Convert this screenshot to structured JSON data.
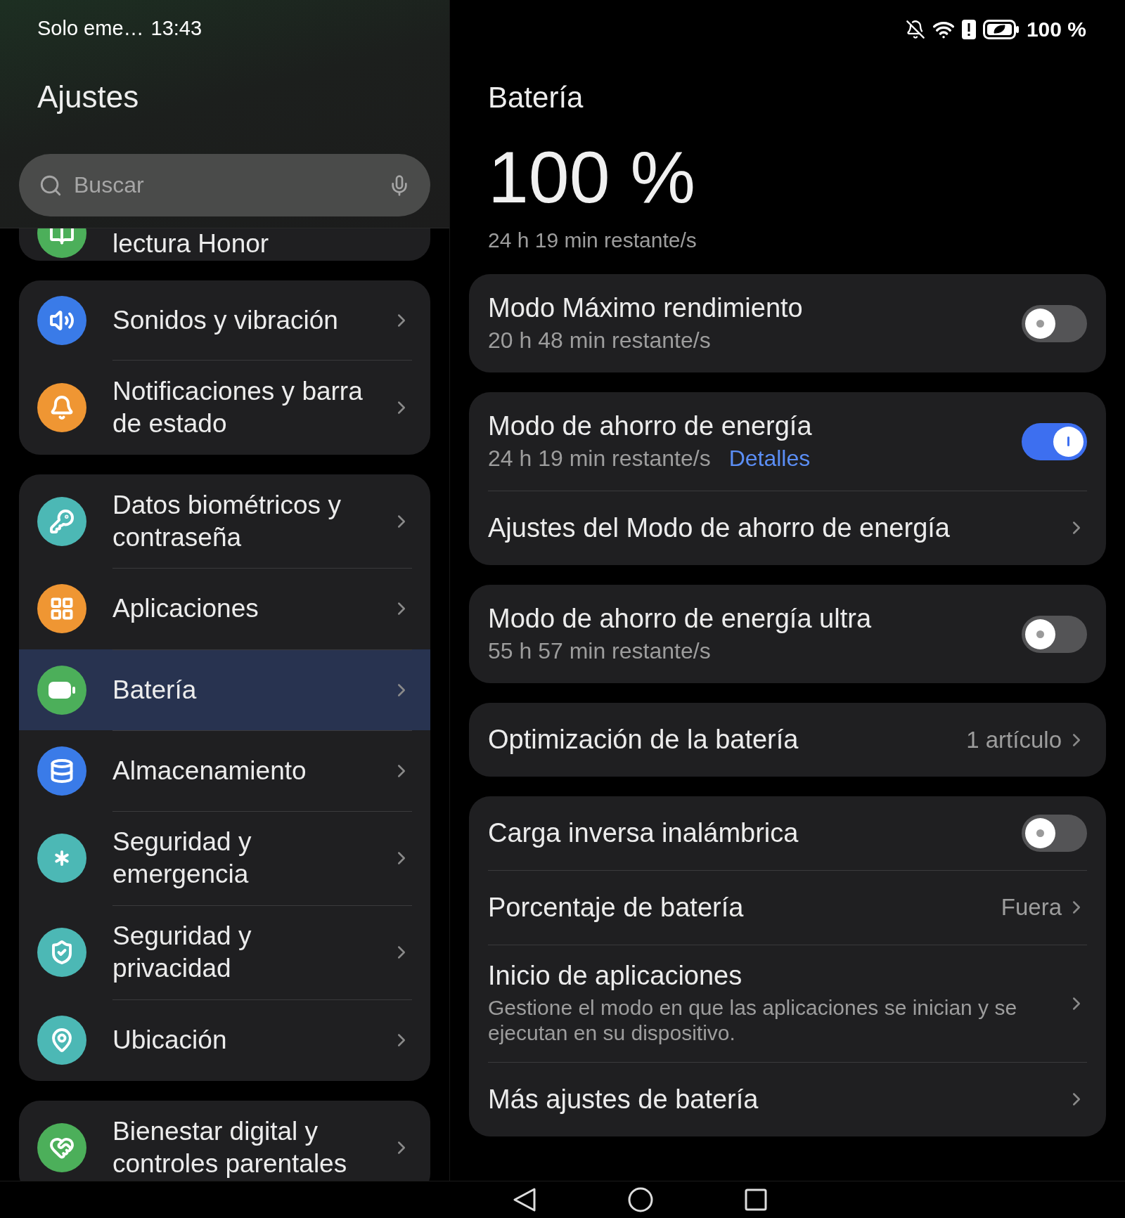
{
  "status_bar": {
    "carrier": "Solo eme…",
    "time": "13:43",
    "battery": "100 %"
  },
  "sidebar": {
    "title": "Ajustes",
    "search": {
      "placeholder": "Buscar"
    },
    "groups": [
      {
        "items": [
          {
            "label": "lectura Honor",
            "color": "#4caf5a",
            "selected": false
          }
        ]
      },
      {
        "items": [
          {
            "label": "Sonidos y vibración",
            "color": "#3a7be8",
            "selected": false
          },
          {
            "label": "Notificaciones y barra de estado",
            "color": "#ef9633",
            "selected": false
          }
        ]
      },
      {
        "items": [
          {
            "label": "Datos biométricos y contraseña",
            "color": "#4cb8b5",
            "selected": false
          },
          {
            "label": "Aplicaciones",
            "color": "#ef9633",
            "selected": false
          },
          {
            "label": "Batería",
            "color": "#4caf5a",
            "selected": true
          },
          {
            "label": "Almacenamiento",
            "color": "#3a7be8",
            "selected": false
          },
          {
            "label": "Seguridad y emergencia",
            "color": "#4cb8b5",
            "selected": false
          },
          {
            "label": "Seguridad y privacidad",
            "color": "#4cb8b5",
            "selected": false
          },
          {
            "label": "Ubicación",
            "color": "#4cb8b5",
            "selected": false
          }
        ]
      },
      {
        "items": [
          {
            "label": "Bienestar digital y controles parentales",
            "color": "#4caf5a",
            "selected": false
          }
        ]
      }
    ]
  },
  "detail": {
    "title": "Batería",
    "level_text": "100 %",
    "remaining": "24 h 19 min restante/s",
    "groups": [
      {
        "rows": [
          {
            "kind": "toggle",
            "title": "Modo Máximo rendimiento",
            "subtitle": "20 h 48 min restante/s",
            "on": false
          }
        ]
      },
      {
        "rows": [
          {
            "kind": "toggle",
            "title": "Modo de ahorro de energía",
            "subtitle": "24 h 19 min restante/s",
            "link_text": "Detalles",
            "on": true
          },
          {
            "kind": "link",
            "title": "Ajustes del Modo de ahorro de energía"
          }
        ]
      },
      {
        "rows": [
          {
            "kind": "toggle",
            "title": "Modo de ahorro de energía ultra",
            "subtitle": "55 h 57 min restante/s",
            "on": false
          }
        ]
      },
      {
        "rows": [
          {
            "kind": "link",
            "title": "Optimización de la batería",
            "value": "1 artículo"
          }
        ]
      },
      {
        "rows": [
          {
            "kind": "toggle",
            "title": "Carga inversa inalámbrica",
            "on": false
          },
          {
            "kind": "link",
            "title": "Porcentaje de batería",
            "value": "Fuera"
          },
          {
            "kind": "link",
            "title": "Inicio de aplicaciones",
            "description": "Gestione el modo en que las aplicaciones se inician y se ejecutan en su dispositivo."
          },
          {
            "kind": "link",
            "title": "Más ajustes de batería"
          }
        ]
      }
    ]
  }
}
